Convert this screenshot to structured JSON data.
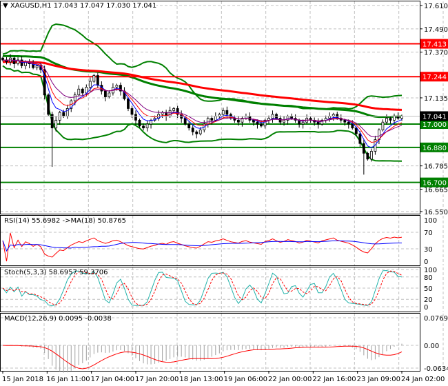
{
  "header": {
    "symbol": "XAGUSD,H1",
    "ohlc": "17.043 17.047 17.030 17.041"
  },
  "chart_data": {
    "type": "candlestick",
    "title": "XAGUSD,H1 17.043 17.047 17.030 17.041",
    "price_axis": {
      "ticks": [
        "17.610",
        "17.490",
        "17.370",
        "17.135",
        "16.785",
        "16.665",
        "16.550"
      ],
      "range": [
        16.55,
        17.61
      ]
    },
    "current_price": "17.041",
    "levels": [
      {
        "value": "17.413",
        "color": "#ff0000"
      },
      {
        "value": "17.244",
        "color": "#ff0000"
      },
      {
        "value": "17.000",
        "color": "#008000"
      },
      {
        "value": "16.880",
        "color": "#008000"
      },
      {
        "value": "16.700",
        "color": "#008000"
      }
    ],
    "closes": [
      17.33,
      17.32,
      17.34,
      17.31,
      17.33,
      17.3,
      17.32,
      17.31,
      17.29,
      17.3,
      17.28,
      17.15,
      17.05,
      16.98,
      17.02,
      17.06,
      17.04,
      17.08,
      17.12,
      17.15,
      17.18,
      17.16,
      17.19,
      17.22,
      17.25,
      17.2,
      17.17,
      17.14,
      17.16,
      17.19,
      17.2,
      17.17,
      17.13,
      17.08,
      17.05,
      17.02,
      16.99,
      16.98,
      17.0,
      17.02,
      17.03,
      17.05,
      17.06,
      17.04,
      17.07,
      17.08,
      17.05,
      17.03,
      17.0,
      16.98,
      16.96,
      16.95,
      16.97,
      17.0,
      17.03,
      17.02,
      17.04,
      17.05,
      17.07,
      17.05,
      17.03,
      17.02,
      17.01,
      17.03,
      17.04,
      17.02,
      17.01,
      17.0,
      16.99,
      17.02,
      17.03,
      17.05,
      17.03,
      17.01,
      17.02,
      17.04,
      17.03,
      17.02,
      17.0,
      17.01,
      17.03,
      17.02,
      17.01,
      17.0,
      17.02,
      17.03,
      17.04,
      17.05,
      17.03,
      17.02,
      17.01,
      17.0,
      16.98,
      16.95,
      16.9,
      16.85,
      16.82,
      16.86,
      16.92,
      16.97,
      17.01,
      17.03,
      17.02,
      17.04,
      17.03,
      17.041
    ],
    "time_labels": [
      "15 Jan 2018",
      "16 Jan 11:00",
      "17 Jan 04:00",
      "17 Jan 20:00",
      "18 Jan 13:00",
      "19 Jan 06:00",
      "22 Jan 00:00",
      "22 Jan 16:00",
      "23 Jan 09:00",
      "24 Jan 02:00"
    ],
    "rsi": {
      "label": "RSI(14) 55.6982  ->MA(18) 50.8765",
      "ticks": [
        "100",
        "70",
        "30",
        "0"
      ]
    },
    "stoch": {
      "label": "Stoch(5,3,3) 58.6957 59.3706",
      "ticks": [
        "100",
        "80",
        "50",
        "20",
        "0"
      ]
    },
    "macd": {
      "label": "MACD(12,26,9) 0.0095 -0.0038",
      "ticks": [
        "0.0769",
        "0.00",
        "-0.0634"
      ]
    }
  }
}
